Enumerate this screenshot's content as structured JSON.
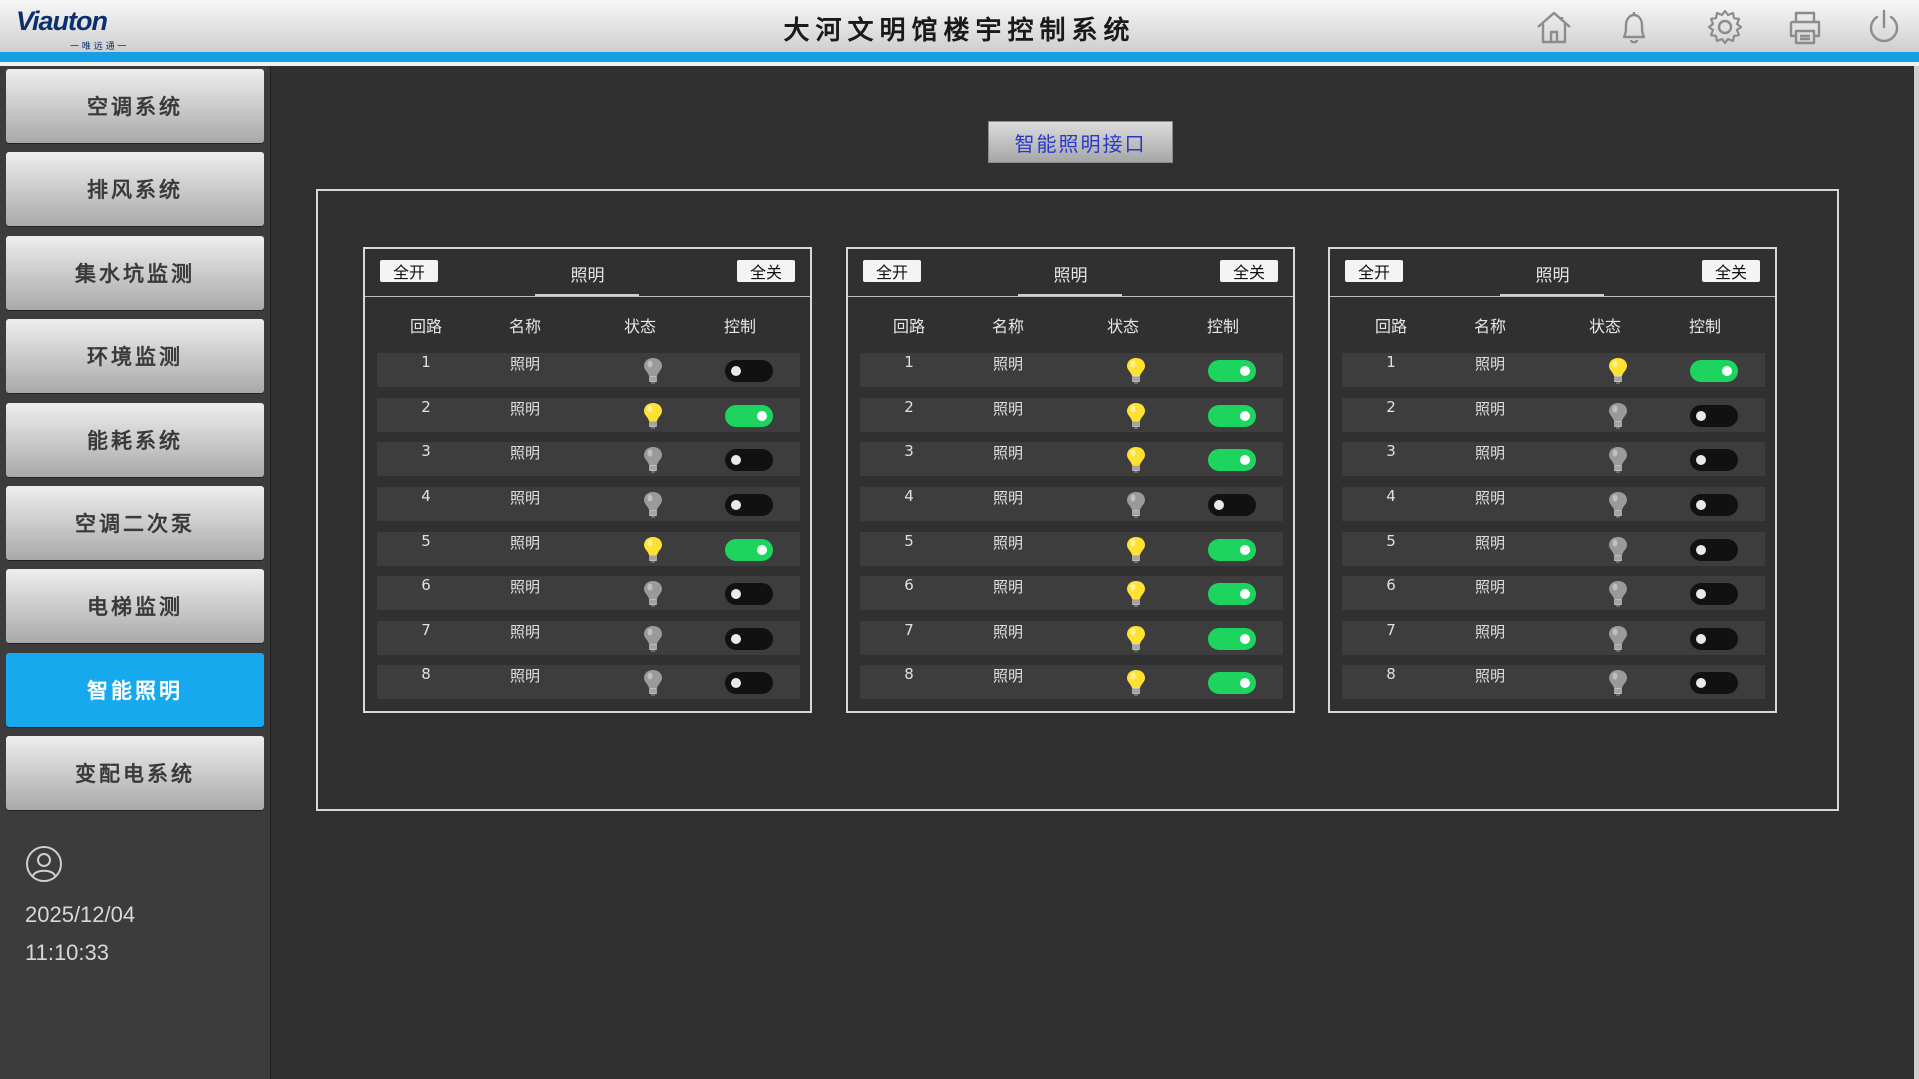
{
  "header": {
    "logo_text": "Viauton",
    "logo_sub": "一 唯 远 通 一",
    "title": "大河文明馆楼宇控制系统",
    "icons": [
      "home-icon",
      "bell-icon",
      "gear-icon",
      "printer-icon",
      "power-icon"
    ]
  },
  "colors": {
    "accent": "#16a9ee",
    "toggle_on": "#1dd55e",
    "bulb_on": "#ffe033",
    "bulb_off": "#9a9a9a"
  },
  "sidebar": {
    "items": [
      {
        "label": "空调系统",
        "active": false
      },
      {
        "label": "排风系统",
        "active": false
      },
      {
        "label": "集水坑监测",
        "active": false
      },
      {
        "label": "环境监测",
        "active": false
      },
      {
        "label": "能耗系统",
        "active": false
      },
      {
        "label": "空调二次泵",
        "active": false
      },
      {
        "label": "电梯监测",
        "active": false
      },
      {
        "label": "智能照明",
        "active": true
      },
      {
        "label": "变配电系统",
        "active": false
      }
    ],
    "user_icon": "user-icon",
    "date": "2025/12/04",
    "time": "11:10:33"
  },
  "main": {
    "interface_button": "智能照明接口",
    "panels": [
      {
        "all_on_label": "全开",
        "title": "照明",
        "all_off_label": "全关",
        "columns": [
          "回路",
          "名称",
          "状态",
          "控制"
        ],
        "rows": [
          {
            "loop": "1",
            "name": "照明",
            "on": false
          },
          {
            "loop": "2",
            "name": "照明",
            "on": true
          },
          {
            "loop": "3",
            "name": "照明",
            "on": false
          },
          {
            "loop": "4",
            "name": "照明",
            "on": false
          },
          {
            "loop": "5",
            "name": "照明",
            "on": true
          },
          {
            "loop": "6",
            "name": "照明",
            "on": false
          },
          {
            "loop": "7",
            "name": "照明",
            "on": false
          },
          {
            "loop": "8",
            "name": "照明",
            "on": false
          }
        ]
      },
      {
        "all_on_label": "全开",
        "title": "照明",
        "all_off_label": "全关",
        "columns": [
          "回路",
          "名称",
          "状态",
          "控制"
        ],
        "rows": [
          {
            "loop": "1",
            "name": "照明",
            "on": true
          },
          {
            "loop": "2",
            "name": "照明",
            "on": true
          },
          {
            "loop": "3",
            "name": "照明",
            "on": true
          },
          {
            "loop": "4",
            "name": "照明",
            "on": false
          },
          {
            "loop": "5",
            "name": "照明",
            "on": true
          },
          {
            "loop": "6",
            "name": "照明",
            "on": true
          },
          {
            "loop": "7",
            "name": "照明",
            "on": true
          },
          {
            "loop": "8",
            "name": "照明",
            "on": true
          }
        ]
      },
      {
        "all_on_label": "全开",
        "title": "照明",
        "all_off_label": "全关",
        "columns": [
          "回路",
          "名称",
          "状态",
          "控制"
        ],
        "rows": [
          {
            "loop": "1",
            "name": "照明",
            "on": true
          },
          {
            "loop": "2",
            "name": "照明",
            "on": false
          },
          {
            "loop": "3",
            "name": "照明",
            "on": false
          },
          {
            "loop": "4",
            "name": "照明",
            "on": false
          },
          {
            "loop": "5",
            "name": "照明",
            "on": false
          },
          {
            "loop": "6",
            "name": "照明",
            "on": false
          },
          {
            "loop": "7",
            "name": "照明",
            "on": false
          },
          {
            "loop": "8",
            "name": "照明",
            "on": false
          }
        ]
      }
    ]
  }
}
